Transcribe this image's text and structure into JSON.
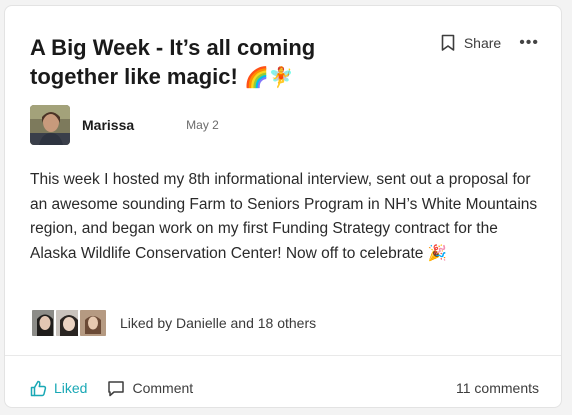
{
  "post": {
    "title": "A Big Week - It’s all coming together like magic!",
    "title_emoji": "🌈🧚",
    "author": "Marissa",
    "date": "May 2",
    "body": "This week I hosted my 8th informational interview, sent out a proposal for an awesome sounding Farm to Seniors Program in NH’s White Mountains region, and began work on my first Funding Strategy contract for the Alaska Wildlife Conservation Center! Now off to celebrate 🎉"
  },
  "header": {
    "share_label": "Share",
    "more_label": "•••",
    "bookmark_icon": "bookmark-icon"
  },
  "likes": {
    "text": "Liked by Danielle and 18 others"
  },
  "footer": {
    "liked_label": "Liked",
    "comment_label": "Comment",
    "comments_count": "11 comments"
  },
  "colors": {
    "accent": "#19a8b5",
    "text": "#1c1c1c",
    "muted": "#6b6b6b",
    "background": "#f3f3f3",
    "card": "#ffffff"
  }
}
